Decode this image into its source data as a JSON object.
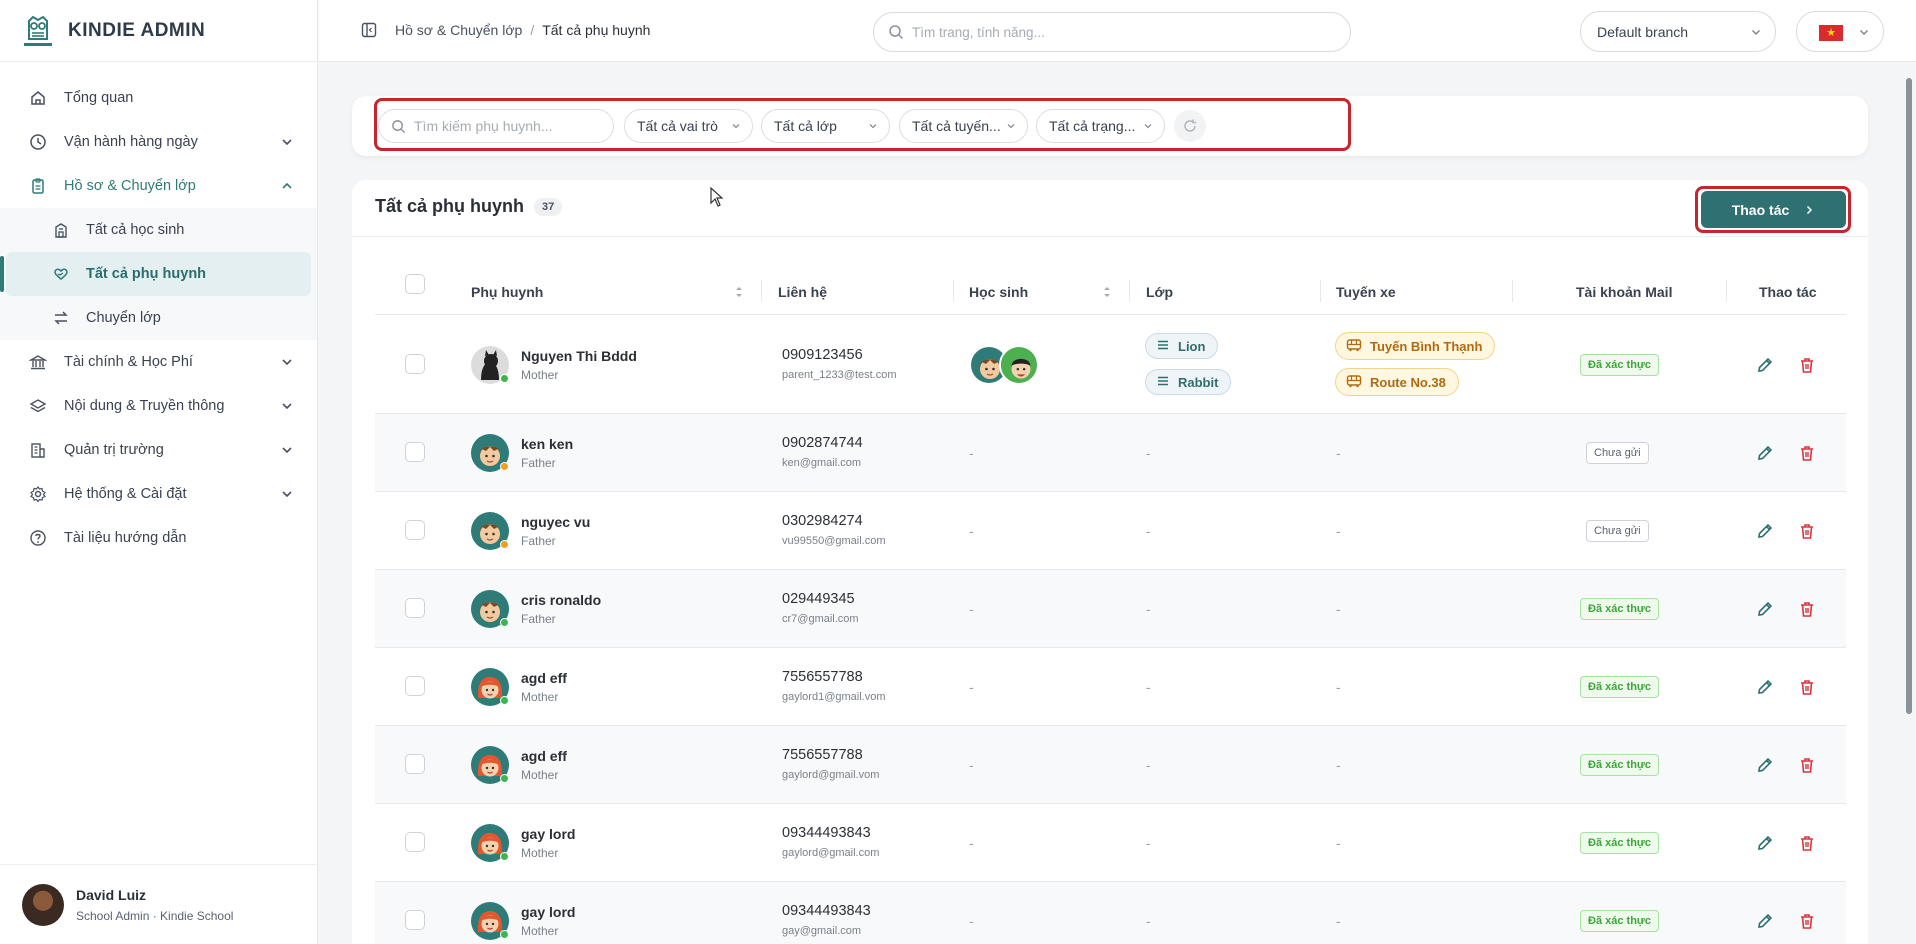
{
  "brand": {
    "name": "KINDIE ADMIN"
  },
  "sidebar": {
    "items": [
      {
        "label": "Tổng quan",
        "icon": "home-icon"
      },
      {
        "label": "Vận hành hàng ngày",
        "icon": "clock-icon"
      },
      {
        "label": "Hồ sơ & Chuyển lớp",
        "icon": "clipboard-icon"
      },
      {
        "label": "Tài chính & Học Phí",
        "icon": "bank-icon"
      },
      {
        "label": "Nội dung & Truyền thông",
        "icon": "layers-icon"
      },
      {
        "label": "Quản trị trường",
        "icon": "building-icon"
      },
      {
        "label": "Hệ thống & Cài đặt",
        "icon": "gear-icon"
      },
      {
        "label": "Tài liệu hướng dẫn",
        "icon": "help-circle-icon"
      }
    ],
    "subitems": [
      {
        "label": "Tất cả học sinh",
        "icon": "school-icon"
      },
      {
        "label": "Tất cả phụ huynh",
        "icon": "heart-hands-icon"
      },
      {
        "label": "Chuyển lớp",
        "icon": "transfer-icon"
      }
    ],
    "user": {
      "name": "David Luiz",
      "role": "School Admin · Kindie School"
    }
  },
  "topbar": {
    "breadcrumb": {
      "parent": "Hồ sơ & Chuyển lớp",
      "separator": "/",
      "current": "Tất cả phụ huynh"
    },
    "search_placeholder": "Tìm trang, tính năng...",
    "branch": "Default branch",
    "language_flag": "vietnam-flag-icon"
  },
  "filters": {
    "search_placeholder": "Tìm kiếm phụ huynh...",
    "role": "Tất cả vai trò",
    "class": "Tất cả lớp",
    "route": "Tất cả tuyến...",
    "status": "Tất cả trạng..."
  },
  "table": {
    "title": "Tất cả phụ huynh",
    "count": "37",
    "action_button": "Thao tác",
    "columns": [
      "Phụ huynh",
      "Liên hệ",
      "Học sinh",
      "Lớp",
      "Tuyến xe",
      "Tài khoản Mail",
      "Thao tác"
    ],
    "rows": [
      {
        "name": "Nguyen Thi Bddd",
        "role": "Mother",
        "phone": "0909123456",
        "email": "parent_1233@test.com",
        "students": "",
        "classes": [
          "Lion",
          "Rabbit"
        ],
        "routes": [
          "Tuyến Bình Thạnh",
          "Route No.38"
        ],
        "mail": "Đã xác thực",
        "mail_ok": true,
        "avatar": "cat",
        "dot": "#3fb34f"
      },
      {
        "name": "ken ken",
        "role": "Father",
        "phone": "0902874744",
        "email": "ken@gmail.com",
        "students": "-",
        "class_dash": "-",
        "route_dash": "-",
        "mail": "Chưa gửi",
        "mail_ok": false,
        "avatar": "boy",
        "dot": "#f0a020"
      },
      {
        "name": "nguyec vu",
        "role": "Father",
        "phone": "0302984274",
        "email": "vu99550@gmail.com",
        "students": "-",
        "class_dash": "-",
        "route_dash": "-",
        "mail": "Chưa gửi",
        "mail_ok": false,
        "avatar": "boy",
        "dot": "#f0a020"
      },
      {
        "name": "cris ronaldo",
        "role": "Father",
        "phone": "029449345",
        "email": "cr7@gmail.com",
        "students": "-",
        "class_dash": "-",
        "route_dash": "-",
        "mail": "Đã xác thực",
        "mail_ok": true,
        "avatar": "boy",
        "dot": "#3fb34f"
      },
      {
        "name": "agd eff",
        "role": "Mother",
        "phone": "7556557788",
        "email": "gaylord1@gmail.vom",
        "students": "-",
        "class_dash": "-",
        "route_dash": "-",
        "mail": "Đã xác thực",
        "mail_ok": true,
        "avatar": "girl",
        "dot": "#3fb34f"
      },
      {
        "name": "agd eff",
        "role": "Mother",
        "phone": "7556557788",
        "email": "gaylord@gmail.vom",
        "students": "-",
        "class_dash": "-",
        "route_dash": "-",
        "mail": "Đã xác thực",
        "mail_ok": true,
        "avatar": "girl",
        "dot": "#3fb34f"
      },
      {
        "name": "gay lord",
        "role": "Mother",
        "phone": "09344493843",
        "email": "gaylord@gmail.com",
        "students": "-",
        "class_dash": "-",
        "route_dash": "-",
        "mail": "Đã xác thực",
        "mail_ok": true,
        "avatar": "girl",
        "dot": "#3fb34f"
      },
      {
        "name": "gay lord",
        "role": "Mother",
        "phone": "09344493843",
        "email": "gay@gmail.com",
        "students": "-",
        "class_dash": "-",
        "route_dash": "-",
        "mail": "Đã xác thực",
        "mail_ok": true,
        "avatar": "girl",
        "dot": "#3fb34f"
      }
    ]
  },
  "colors": {
    "accent": "#2f7172",
    "highlight": "#c8242c",
    "verified": "#3da63a",
    "delete": "#d9363e"
  }
}
